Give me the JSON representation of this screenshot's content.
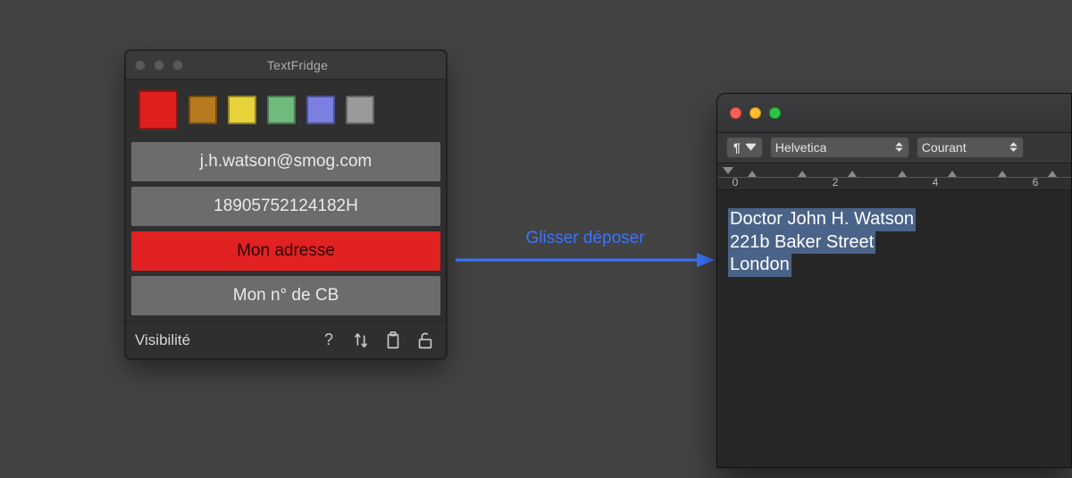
{
  "textfridge": {
    "title": "TextFridge",
    "swatches": [
      {
        "color": "#e01f1f",
        "selected": true
      },
      {
        "color": "#b77a1e",
        "selected": false
      },
      {
        "color": "#e7d23a",
        "selected": false
      },
      {
        "color": "#6fba7c",
        "selected": false
      },
      {
        "color": "#7a7fe0",
        "selected": false
      },
      {
        "color": "#9a9a9a",
        "selected": false
      }
    ],
    "items": [
      {
        "label": "j.h.watson@smog.com",
        "selected": false
      },
      {
        "label": "18905752124182H",
        "selected": false
      },
      {
        "label": "Mon adresse",
        "selected": true
      },
      {
        "label": "Mon n° de CB",
        "selected": false
      }
    ],
    "footer_label": "Visibilité",
    "icons": {
      "help": "?",
      "sort": "sort-icon",
      "paste": "clipboard-icon",
      "lock": "lock-open-icon"
    }
  },
  "arrow": {
    "label": "Glisser déposer",
    "color": "#3a74ff"
  },
  "textedit": {
    "toolbar": {
      "pilcrow": "¶",
      "font": "Helvetica",
      "style": "Courant"
    },
    "ruler": {
      "marks": [
        "0",
        "2",
        "4",
        "6"
      ]
    },
    "body_lines": [
      "Doctor John H. Watson",
      "221b Baker Street",
      "London"
    ]
  }
}
